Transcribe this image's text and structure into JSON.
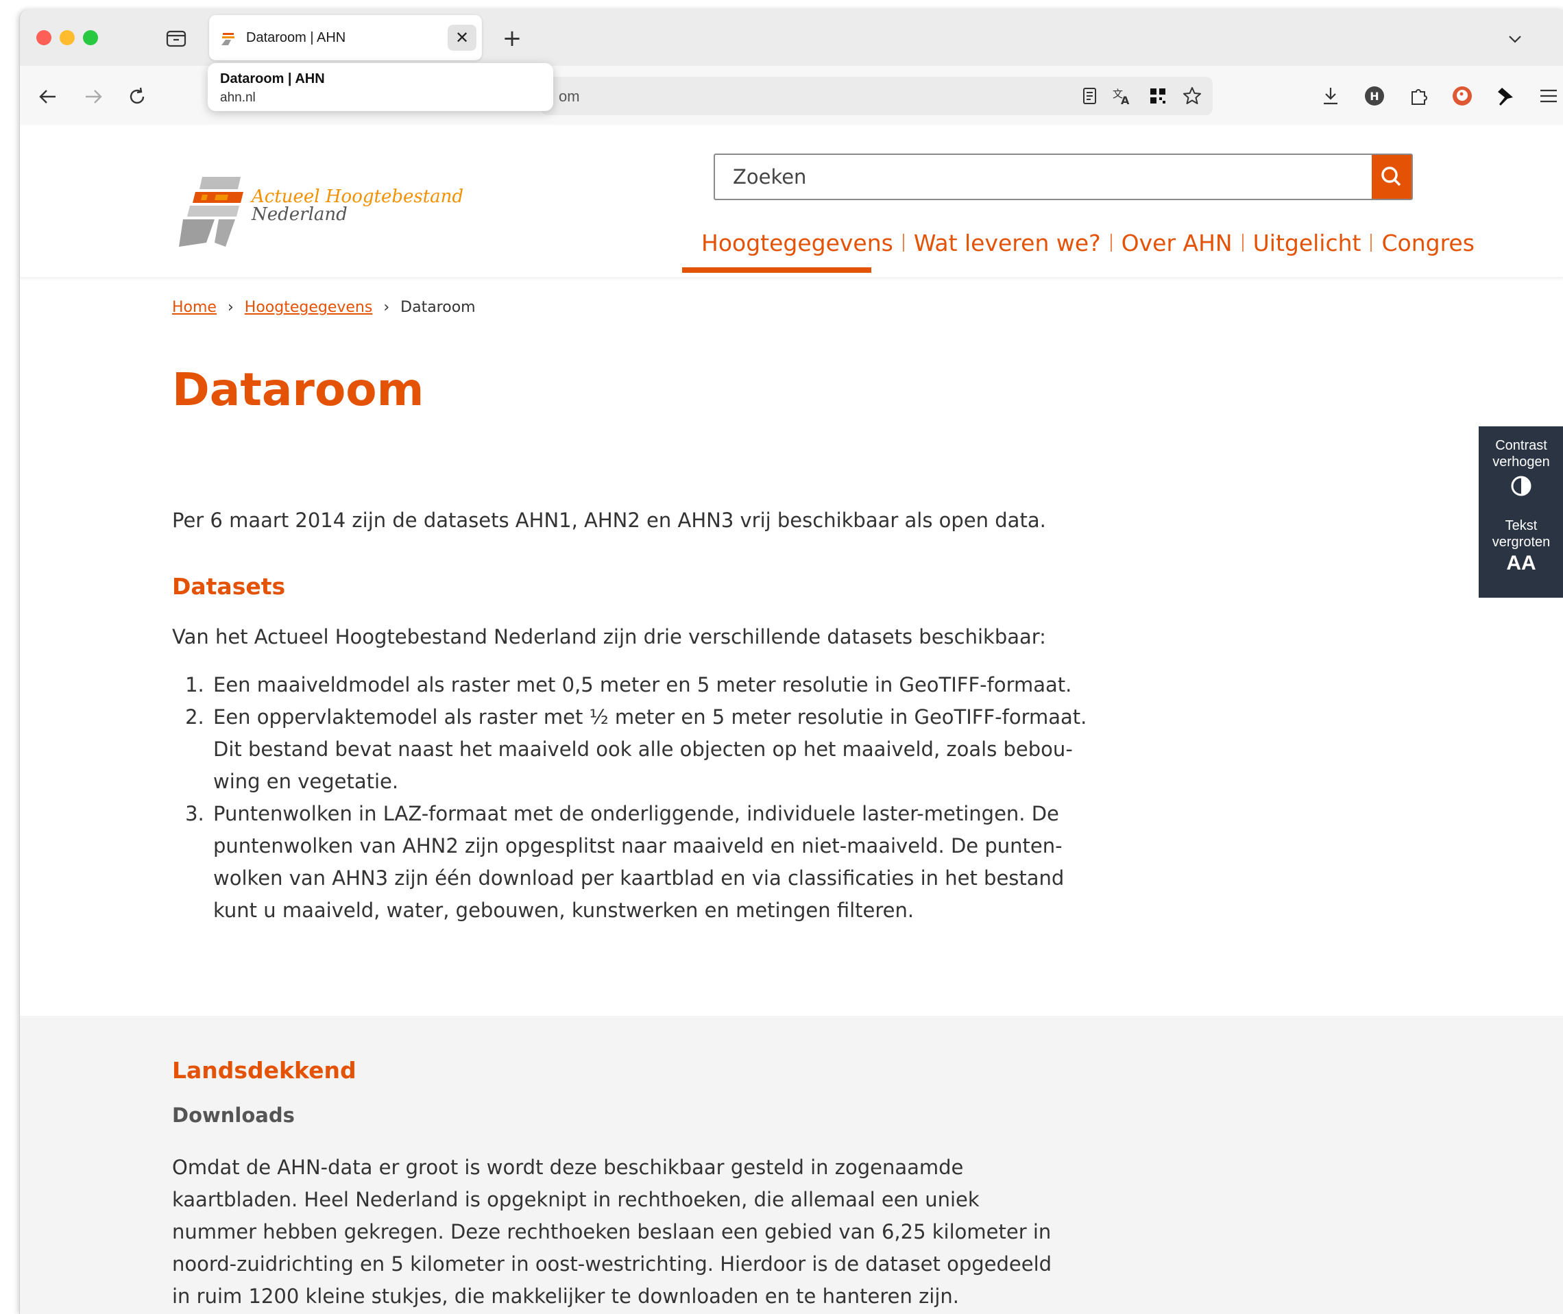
{
  "browser": {
    "tab": {
      "title": "Dataroom | AHN"
    },
    "tooltip": {
      "title": "Dataroom | AHN",
      "url": "ahn.nl"
    },
    "urlbar": {
      "visible_text": "om"
    },
    "icons": [
      "sidebar-toggle-icon",
      "back-icon",
      "forward-icon",
      "reload-icon",
      "reader-view-icon",
      "translate-icon",
      "qr-icon",
      "bookmark-star-icon",
      "download-icon",
      "h-extension-icon",
      "extensions-icon",
      "duckduckgo-icon",
      "pin-icon",
      "menu-icon"
    ]
  },
  "site": {
    "logo": {
      "line1": "Actueel Hoogtebestand",
      "line2": "Nederland"
    },
    "search": {
      "placeholder": "Zoeken"
    },
    "nav": [
      "Hoogtegegevens",
      "Wat leveren we?",
      "Over AHN",
      "Uitgelicht",
      "Congres"
    ],
    "active_nav": "Hoogtegegevens",
    "accent_color": "#e35205"
  },
  "breadcrumb": {
    "home": "Home",
    "section": "Hoogtegegevens",
    "current": "Dataroom"
  },
  "page": {
    "title": "Dataroom",
    "intro": "Per 6 maart 2014 zijn de datasets AHN1, AHN2 en AHN3 vrij beschikbaar als open data.",
    "datasets_heading": "Datasets",
    "datasets_intro": "Van het Actueel Hoogtebestand Nederland zijn drie verschillende datasets beschikbaar:",
    "datasets": [
      "Een maaiveldmodel als raster met 0,5 meter en 5 meter resolutie in GeoTIFF-formaat.",
      "Een oppervlaktemodel als raster met ½ meter en 5 meter resolutie in GeoTIFF-formaat. Dit bestand bevat naast het maaiveld ook alle objecten op het maaiveld, zoals bebou­wing en vegetatie.",
      "Puntenwolken in LAZ-formaat met de onderliggende, individuele laster-metingen. De puntenwolken van AHN2 zijn opgesplitst naar maaiveld en niet-maaiveld. De punten­wolken van AHN3 zijn één download per kaartblad en via classificaties in het bestand kunt u maaiveld, water, gebouwen, kunstwerken en metingen filteren."
    ],
    "landsdekkend_heading": "Landsdekkend",
    "downloads_heading": "Downloads",
    "downloads_text": "Omdat de AHN-data er groot is wordt deze beschikbaar gesteld in zogenaamde kaartbladen. Heel Nederland is opgeknipt in rechthoeken, die allemaal een uniek nummer hebben gekregen. Deze rechthoeken beslaan een gebied van 6,25 kilometer in noord-zuidrichting en 5 kilometer in oost-westrichting. Hierdoor is de dataset opgedeeld in ruim 1200 kleine stukjes, die makkelijker te downloaden en te hanteren zijn."
  },
  "accessibility": {
    "contrast_label": "Contrast verhogen",
    "text_label": "Tekst vergroten",
    "text_symbol": "AA"
  }
}
